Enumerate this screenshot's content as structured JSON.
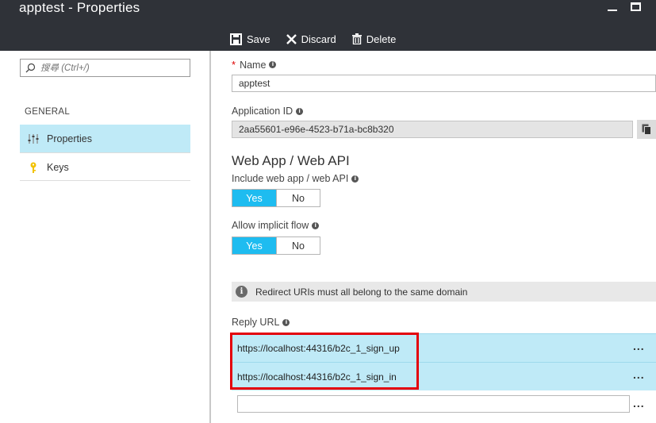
{
  "window": {
    "title": "apptest - Properties"
  },
  "toolbar": {
    "save_label": "Save",
    "discard_label": "Discard",
    "delete_label": "Delete"
  },
  "sidebar": {
    "search_placeholder": "搜尋 (Ctrl+/)",
    "section_label": "GENERAL",
    "items": [
      {
        "label": "Properties",
        "icon": "sliders-icon"
      },
      {
        "label": "Keys",
        "icon": "key-icon"
      }
    ]
  },
  "form": {
    "name_label": "Name",
    "name_required_mark": "*",
    "name_value": "apptest",
    "app_id_label": "Application ID",
    "app_id_value": "2aa55601-e96e-4523-b71a-bc8b320",
    "section_title": "Web App / Web API",
    "include_web_label": "Include web app / web API",
    "include_web_yes": "Yes",
    "include_web_no": "No",
    "implicit_flow_label": "Allow implicit flow",
    "implicit_flow_yes": "Yes",
    "implicit_flow_no": "No",
    "info_message": "Redirect URIs must all belong to the same domain",
    "reply_url_label": "Reply URL",
    "reply_urls": [
      "https://localhost:44316/b2c_1_sign_up",
      "https://localhost:44316/b2c_1_sign_in"
    ],
    "new_reply_url_value": "",
    "more_glyph": "..."
  },
  "colors": {
    "header_bg": "#2f3238",
    "toggle_on": "#1ebcf0",
    "selected_row": "#bfeaf7",
    "highlight_border": "#e3000b"
  }
}
